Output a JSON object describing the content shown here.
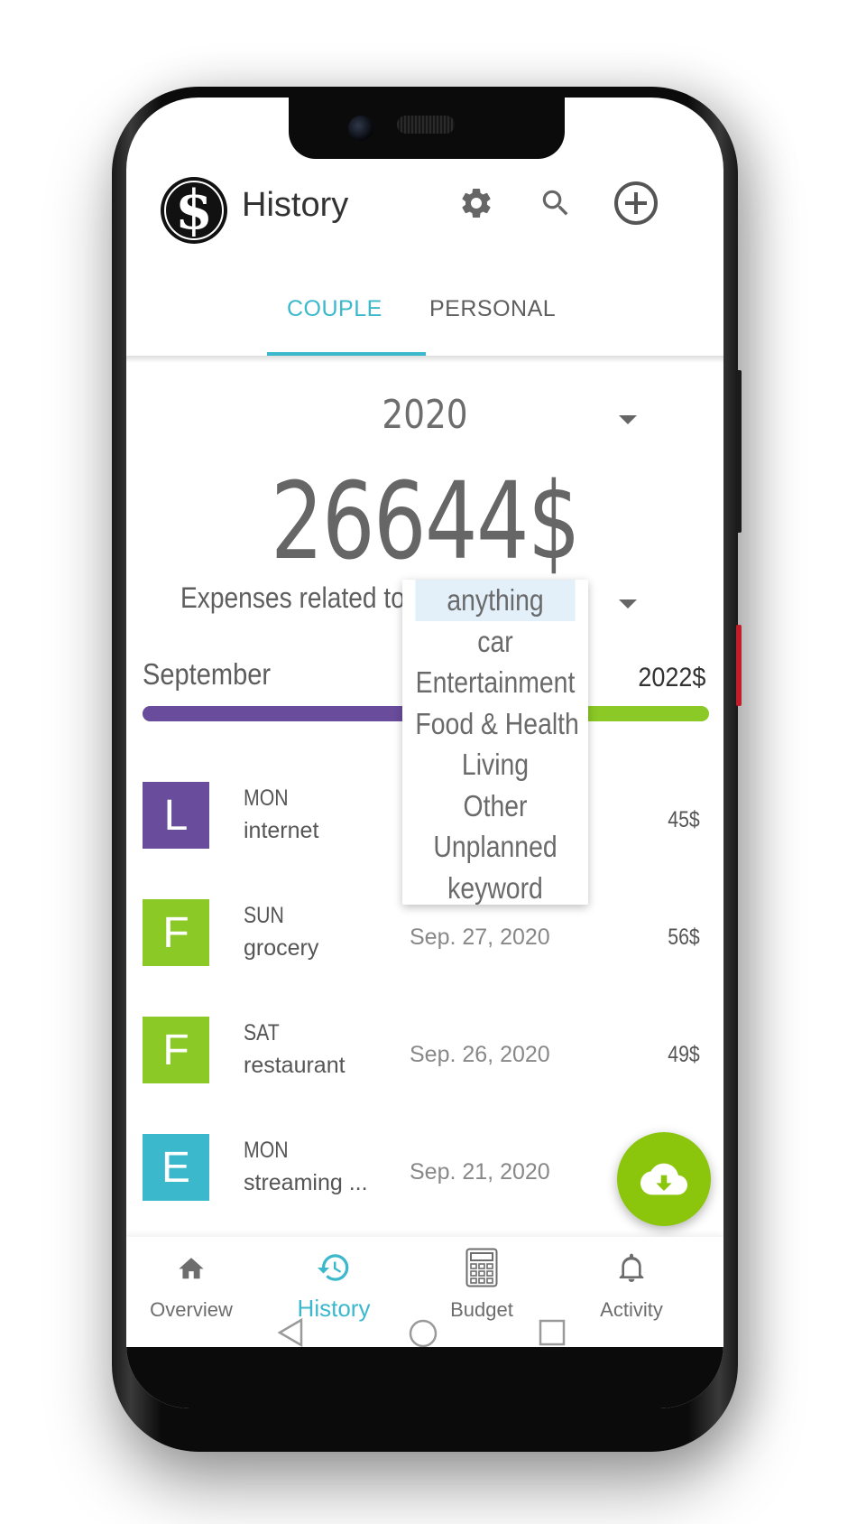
{
  "header": {
    "title": "History"
  },
  "tabs": [
    {
      "label": "COUPLE",
      "active": true
    },
    {
      "label": "PERSONAL",
      "active": false
    }
  ],
  "year_select": {
    "value": "2020"
  },
  "total": "26644$",
  "expenses": {
    "label": "Expenses related to",
    "selected": "anything",
    "options": [
      "anything",
      "car",
      "Entertainment",
      "Food & Health",
      "Living",
      "Other",
      "Unplanned",
      "keyword"
    ]
  },
  "month": {
    "name": "September",
    "amount": "2022$",
    "progress": 0.55
  },
  "transactions": [
    {
      "letter": "L",
      "color": "#6a4c9c",
      "day": "MON",
      "name": "internet",
      "date": "",
      "amount": "45$"
    },
    {
      "letter": "F",
      "color": "#8bc926",
      "day": "SUN",
      "name": "grocery",
      "date": "Sep. 27, 2020",
      "amount": "56$"
    },
    {
      "letter": "F",
      "color": "#8bc926",
      "day": "SAT",
      "name": "restaurant",
      "date": "Sep. 26, 2020",
      "amount": "49$"
    },
    {
      "letter": "E",
      "color": "#3bb8cc",
      "day": "MON",
      "name": "streaming ...",
      "date": "Sep. 21, 2020",
      "amount": ""
    }
  ],
  "nav": [
    {
      "label": "Overview",
      "icon": "home-icon",
      "active": false
    },
    {
      "label": "History",
      "icon": "history-icon",
      "active": true
    },
    {
      "label": "Budget",
      "icon": "calculator-icon",
      "active": false
    },
    {
      "label": "Activity",
      "icon": "bell-icon",
      "active": false
    }
  ],
  "colors": {
    "accent": "#3bb8cc",
    "purple": "#6a4c9c",
    "green": "#8bc926",
    "fab": "#8bc60d"
  }
}
